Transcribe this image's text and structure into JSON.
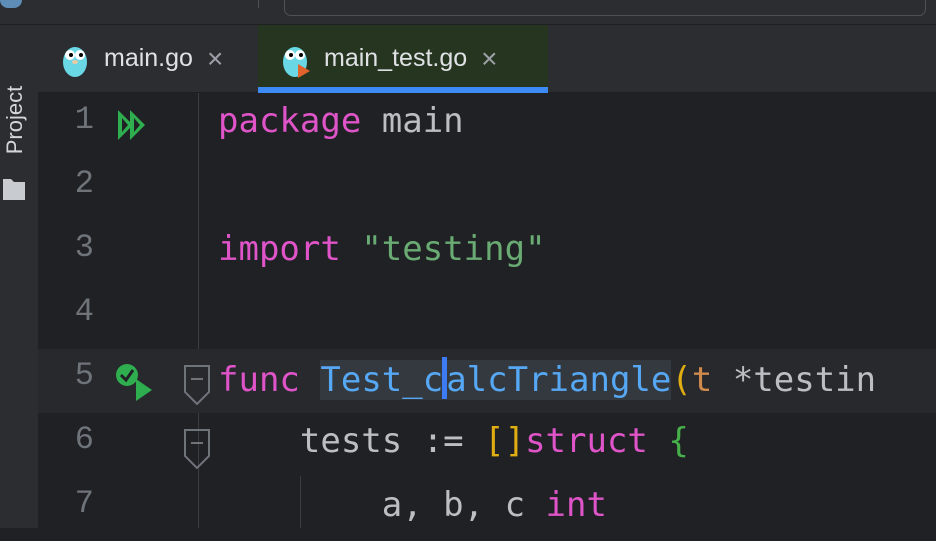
{
  "tool_window": {
    "project_label": "Project"
  },
  "tabs": [
    {
      "label": "main.go",
      "close": "×"
    },
    {
      "label": "main_test.go",
      "close": "×"
    }
  ],
  "editor": {
    "lines": [
      {
        "num": "1",
        "tokens": [
          [
            "kw",
            "package"
          ],
          [
            "plain",
            " main"
          ]
        ]
      },
      {
        "num": "2",
        "tokens": []
      },
      {
        "num": "3",
        "tokens": [
          [
            "kw",
            "import"
          ],
          [
            "plain",
            " "
          ],
          [
            "str",
            "\"testing\""
          ]
        ]
      },
      {
        "num": "4",
        "tokens": []
      },
      {
        "num": "5",
        "tokens": [
          [
            "kw",
            "func"
          ],
          [
            "plain",
            " "
          ],
          [
            "fnhl",
            "Test_c"
          ],
          [
            "caret",
            ""
          ],
          [
            "fnhl",
            "alcTriangle"
          ],
          [
            "yellow",
            "("
          ],
          [
            "param",
            "t"
          ],
          [
            "plain",
            " *testin"
          ]
        ]
      },
      {
        "num": "6",
        "tokens": [
          [
            "plain",
            "    tests := "
          ],
          [
            "yellow",
            "[]"
          ],
          [
            "typ",
            "struct"
          ],
          [
            "plain",
            " "
          ],
          [
            "green-b",
            "{"
          ]
        ]
      },
      {
        "num": "7",
        "tokens": [
          [
            "plain",
            "        a, b, c "
          ],
          [
            "typ",
            "int"
          ]
        ]
      }
    ]
  },
  "colors": {
    "accent": "#3d8af5",
    "run_green": "#28a745",
    "active_tab_bg": "#26351f"
  },
  "icons": [
    "run-all-icon",
    "run-test-icon",
    "gopher-icon",
    "folder-icon",
    "fold-icon",
    "close-icon"
  ]
}
